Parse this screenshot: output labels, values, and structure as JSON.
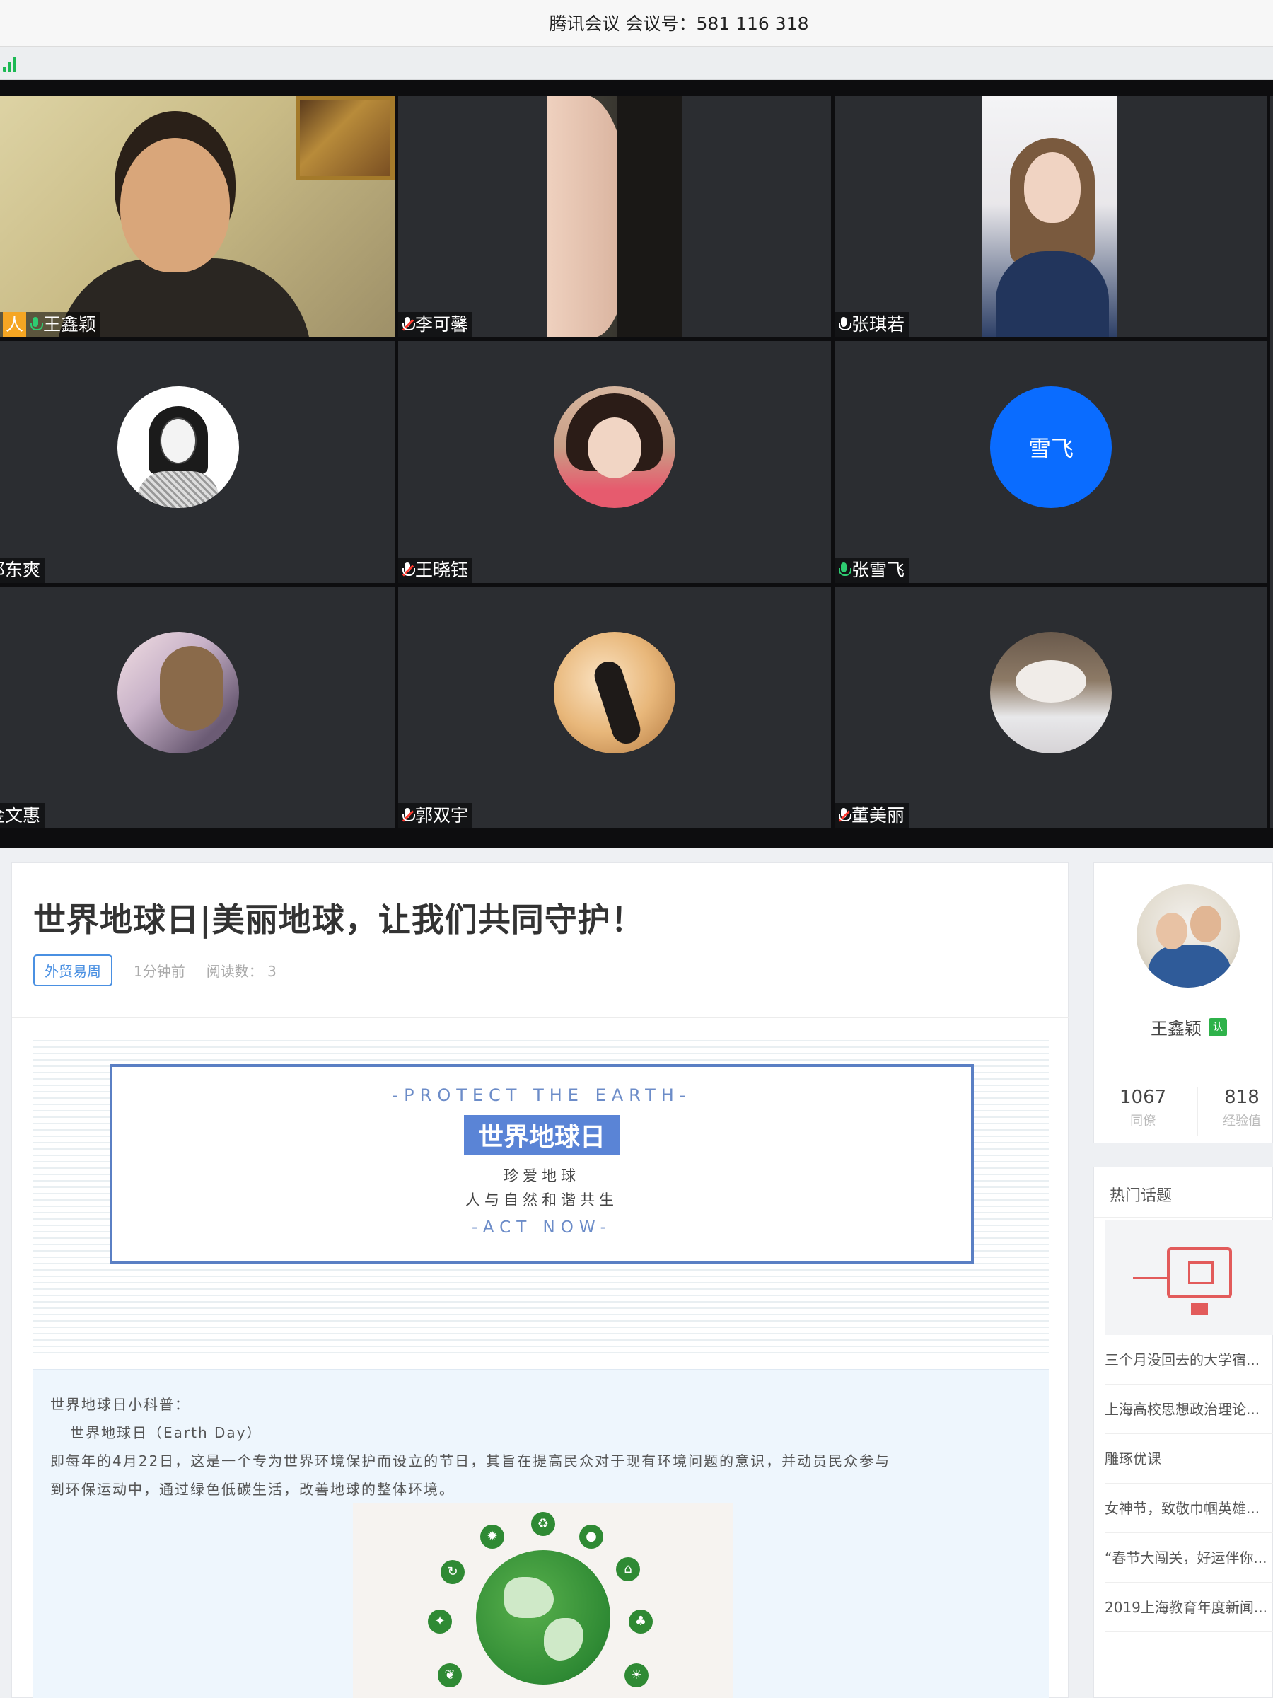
{
  "meeting": {
    "title": "腾讯会议 会议号：581 116 318",
    "participants": [
      {
        "name": "王鑫颖",
        "mic": "on",
        "host_label": "人"
      },
      {
        "name": "李可馨",
        "mic": "off"
      },
      {
        "name": "张琪若",
        "mic": "on"
      },
      {
        "name": "邓东爽",
        "mic": "none"
      },
      {
        "name": "王晓钰",
        "mic": "off"
      },
      {
        "name": "张雪飞",
        "mic": "on",
        "avatar_text": "雪飞"
      },
      {
        "name": "金文惠",
        "mic": "none"
      },
      {
        "name": "郭双宇",
        "mic": "off"
      },
      {
        "name": "董美丽",
        "mic": "off"
      }
    ]
  },
  "article": {
    "title": "世界地球日|美丽地球，让我们共同守护！",
    "tag": "外贸易周",
    "time": "1分钟前",
    "reads": "阅读数： 3",
    "banner": {
      "en": "-PROTECT THE EARTH-",
      "zh": "世界地球日",
      "sub1": "珍爱地球",
      "sub2": "人与自然和谐共生",
      "act": "-ACT NOW-"
    },
    "body": {
      "l1": "世界地球日小科普：",
      "l2": "世界地球日（Earth Day）",
      "l3": "即每年的4月22日，这是一个专为世界环境保护而设立的节日，其旨在提高民众对于现有环境问题的意识，并动员民众参与",
      "l4": "到环保运动中，通过绿色低碳生活，改善地球的整体环境。"
    }
  },
  "profile": {
    "name": "王鑫颖",
    "badge": "认",
    "stat1": {
      "num": "1067",
      "label": "同僚"
    },
    "stat2": {
      "num": "818",
      "label": "经验值"
    }
  },
  "topics": {
    "heading": "热门话题",
    "items": [
      "三个月没回去的大学宿...",
      "上海高校思想政治理论...",
      "雕琢优课",
      "女神节，致敬巾帼英雄...",
      "“春节大闯关，好运伴你...",
      "2019上海教育年度新闻..."
    ]
  },
  "colors": {
    "accent_blue": "#0a6cff",
    "tag_blue": "#4a90e2",
    "host_orange": "#f5a623",
    "mic_green": "#2ecc71",
    "badge_green": "#2eb24a"
  }
}
